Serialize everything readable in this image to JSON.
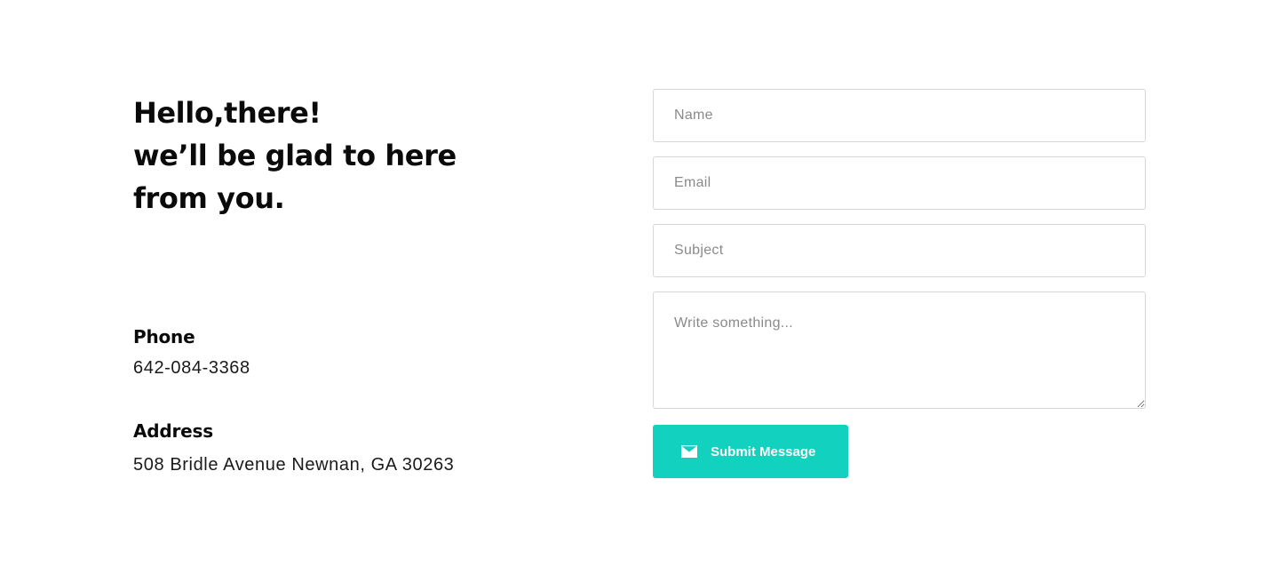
{
  "intro": {
    "lines": [
      "Hello,there!",
      "we’ll be glad to here",
      "from you."
    ]
  },
  "contact": {
    "phone_label": "Phone",
    "phone_value": "642-084-3368",
    "address_label": "Address",
    "address_value": "508 Bridle Avenue Newnan, GA 30263"
  },
  "form": {
    "name_placeholder": "Name",
    "email_placeholder": "Email",
    "subject_placeholder": "Subject",
    "message_placeholder": "Write something...",
    "submit_label": "Submit Message",
    "submit_icon": "envelope-icon"
  },
  "colors": {
    "accent": "#12d1bf",
    "field_border": "#d6d6d6",
    "placeholder": "#8a8a8a",
    "text": "#0a0a0a"
  }
}
